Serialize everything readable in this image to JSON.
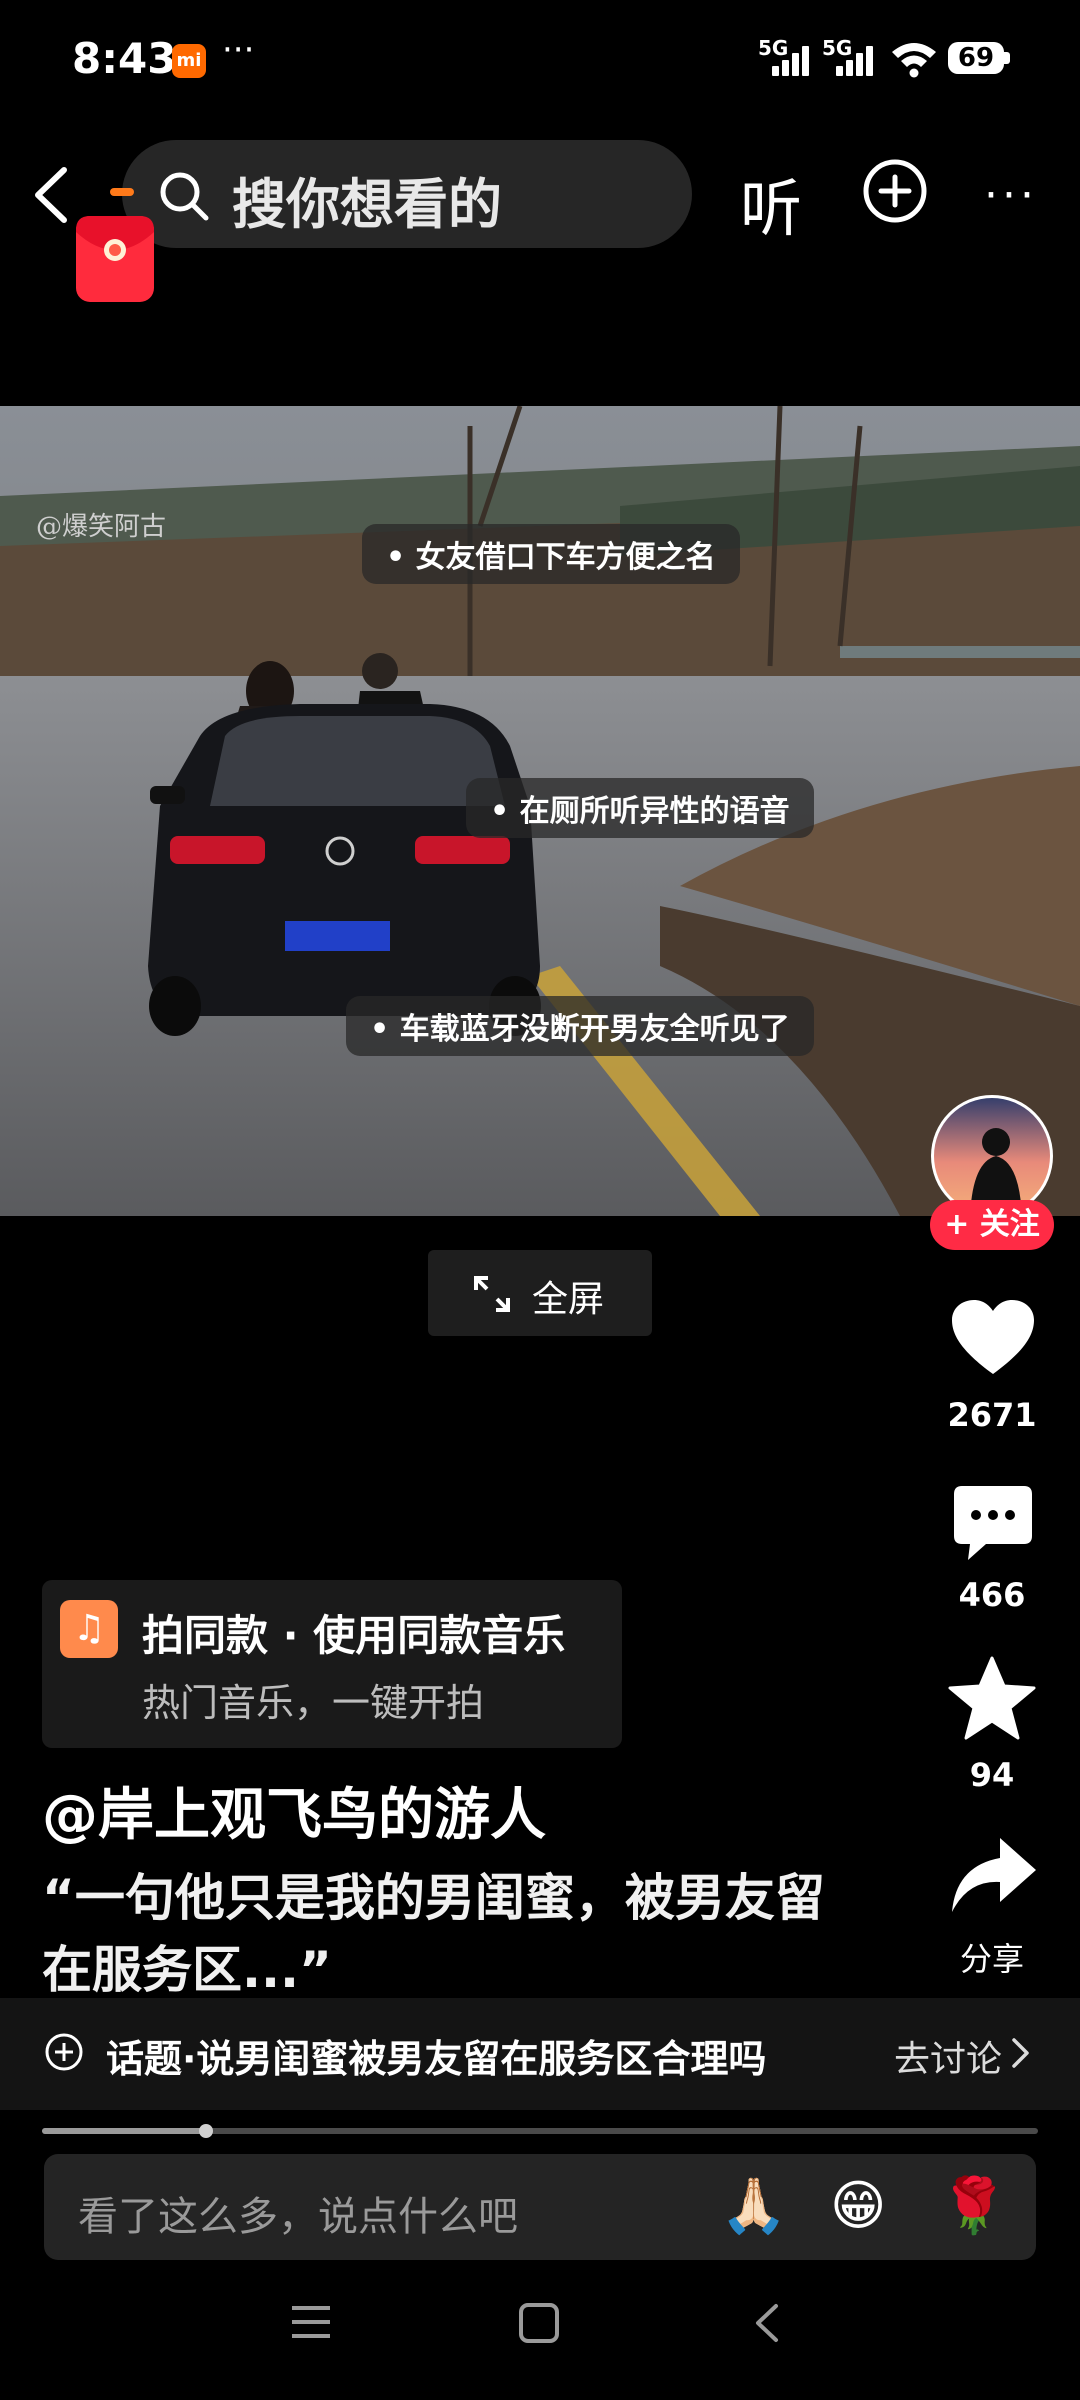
{
  "status_bar": {
    "time": "8:43",
    "mi_badge": "mi",
    "dots": "···",
    "sim1": "5G",
    "sim2": "5G",
    "battery": "69"
  },
  "header": {
    "search_placeholder": "搜你想看的",
    "listen_label": "听",
    "more_label": "···"
  },
  "video": {
    "watermark": "@爆笑阿古",
    "subtitles": [
      "• 女友借口下车方便之名",
      "• 在厕所听异性的语音",
      "• 车载蓝牙没断开男友全听见了"
    ],
    "fullscreen_label": "全屏"
  },
  "side_actions": {
    "follow_label": "+ 关注",
    "likes": "2671",
    "comments": "466",
    "favorites": "94",
    "share_label": "分享"
  },
  "music": {
    "title": "拍同款 · 使用同款音乐",
    "subtitle": "热门音乐，一键开拍"
  },
  "post": {
    "author": "@岸上观飞鸟的游人",
    "description": "“一句他只是我的男闺蜜，被男友留在服务区...”"
  },
  "topic": {
    "text": "话题·说男闺蜜被男友留在服务区合理吗",
    "link": "去讨论"
  },
  "progress": {
    "fraction": 0.165
  },
  "comment_input": {
    "placeholder": "看了这么多，说点什么吧",
    "emojis": [
      "🙏🏻",
      "😁",
      "🌹"
    ]
  },
  "colors": {
    "background": "#000000",
    "follow_red": "#ff2b45",
    "accent_orange": "#ff7a1a"
  }
}
